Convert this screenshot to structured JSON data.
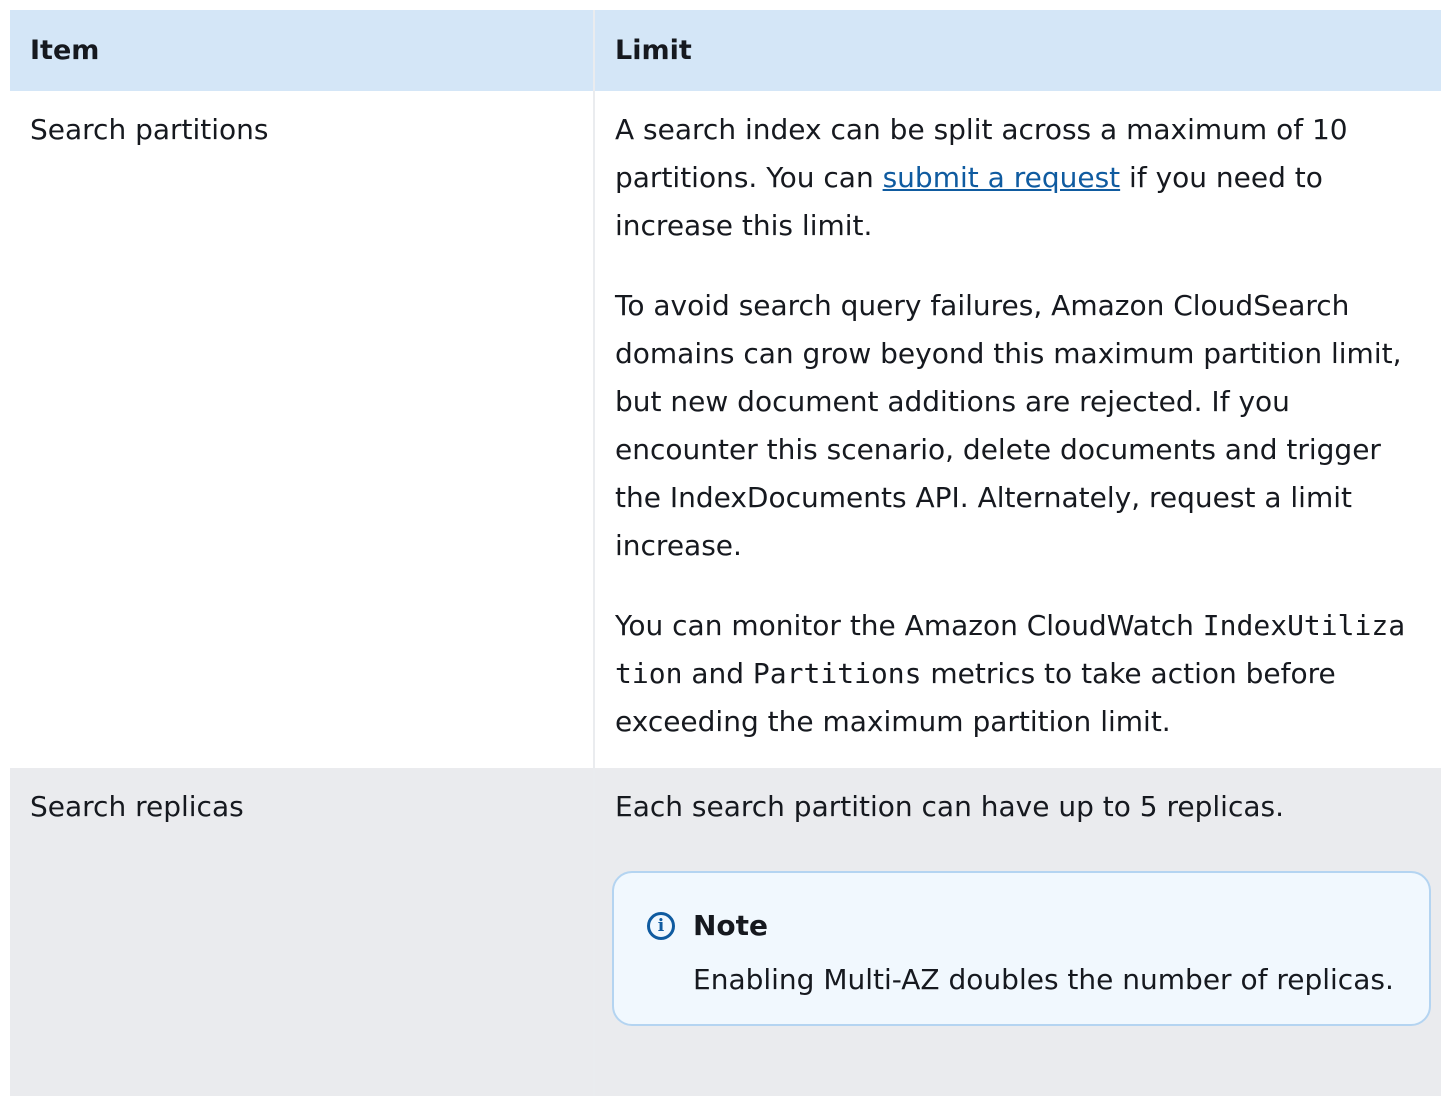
{
  "table": {
    "headers": [
      "Item",
      "Limit"
    ],
    "rows": [
      {
        "item": "Search partitions",
        "p1_before": "A search index can be split across a maximum of 10 partitions. You can ",
        "p1_link": "submit a request",
        "p1_after": " if you need to increase this limit.",
        "p2": "To avoid search query failures, Amazon CloudSearch domains can grow beyond this maximum partition limit, but new document additions are rejected. If you encounter this scenario, delete documents and trigger the IndexDocuments API. Alternately, request a limit increase.",
        "p3_before": "You can monitor the Amazon CloudWatch ",
        "p3_code1": "IndexUtilization",
        "p3_mid": " and ",
        "p3_code2": "Partitions",
        "p3_after": " metrics to take action before exceeding the maximum partition limit."
      },
      {
        "item": "Search replicas",
        "p1": "Each search partition can have up to 5 replicas.",
        "note": {
          "icon": "info-icon",
          "title": "Note",
          "body": "Enabling Multi-AZ doubles the number of replicas."
        }
      }
    ]
  },
  "colors": {
    "header_bg": "#d4e6f7",
    "row_alt_bg": "#eaebee",
    "link": "#0f5ba0",
    "note_bg": "#f1f8fe",
    "note_border": "#b4d4f1"
  }
}
